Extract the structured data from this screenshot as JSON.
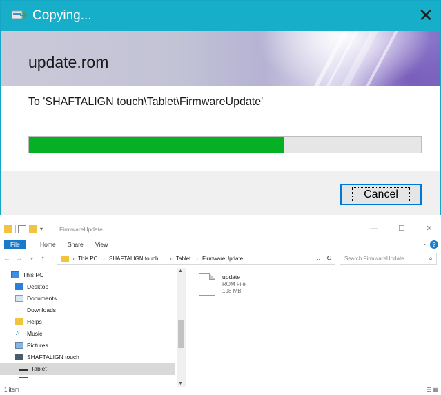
{
  "copy_dialog": {
    "title": "Copying...",
    "close_glyph": "✕",
    "filename": "update.rom",
    "destination": "To 'SHAFTALIGN touch\\Tablet\\FirmwareUpdate'",
    "progress": 0.65,
    "cancel_label": "Cancel",
    "progress_color": "#06b025",
    "titlebar_color": "#17aec9"
  },
  "explorer": {
    "window_title": "FirmwareUpdate",
    "window_buttons": {
      "minimize": "—",
      "maximize": "☐",
      "close": "✕"
    },
    "ribbon_tabs": [
      "File",
      "Home",
      "Share",
      "View"
    ],
    "help_glyph": "?",
    "nav_buttons": {
      "back": "←",
      "forward": "→",
      "recent": "▾",
      "up": "↑"
    },
    "breadcrumb": [
      "This PC",
      "SHAFTALIGN touch",
      "Tablet",
      "FirmwareUpdate"
    ],
    "search_placeholder": "Search FirmwareUpdate",
    "nav_items": [
      {
        "label": "This PC",
        "icon": "computer-icon"
      },
      {
        "label": "Desktop",
        "icon": "desktop-icon"
      },
      {
        "label": "Documents",
        "icon": "documents-icon"
      },
      {
        "label": "Downloads",
        "icon": "downloads-icon"
      },
      {
        "label": "Helps",
        "icon": "folder-icon"
      },
      {
        "label": "Music",
        "icon": "music-icon"
      },
      {
        "label": "Pictures",
        "icon": "pictures-icon"
      },
      {
        "label": "SHAFTALIGN touch",
        "icon": "device-icon"
      },
      {
        "label": "Tablet",
        "icon": "drive-icon",
        "selected": true
      }
    ],
    "file": {
      "name": "update",
      "type": "ROM File",
      "size": "198 MB"
    },
    "status": "1 item"
  }
}
